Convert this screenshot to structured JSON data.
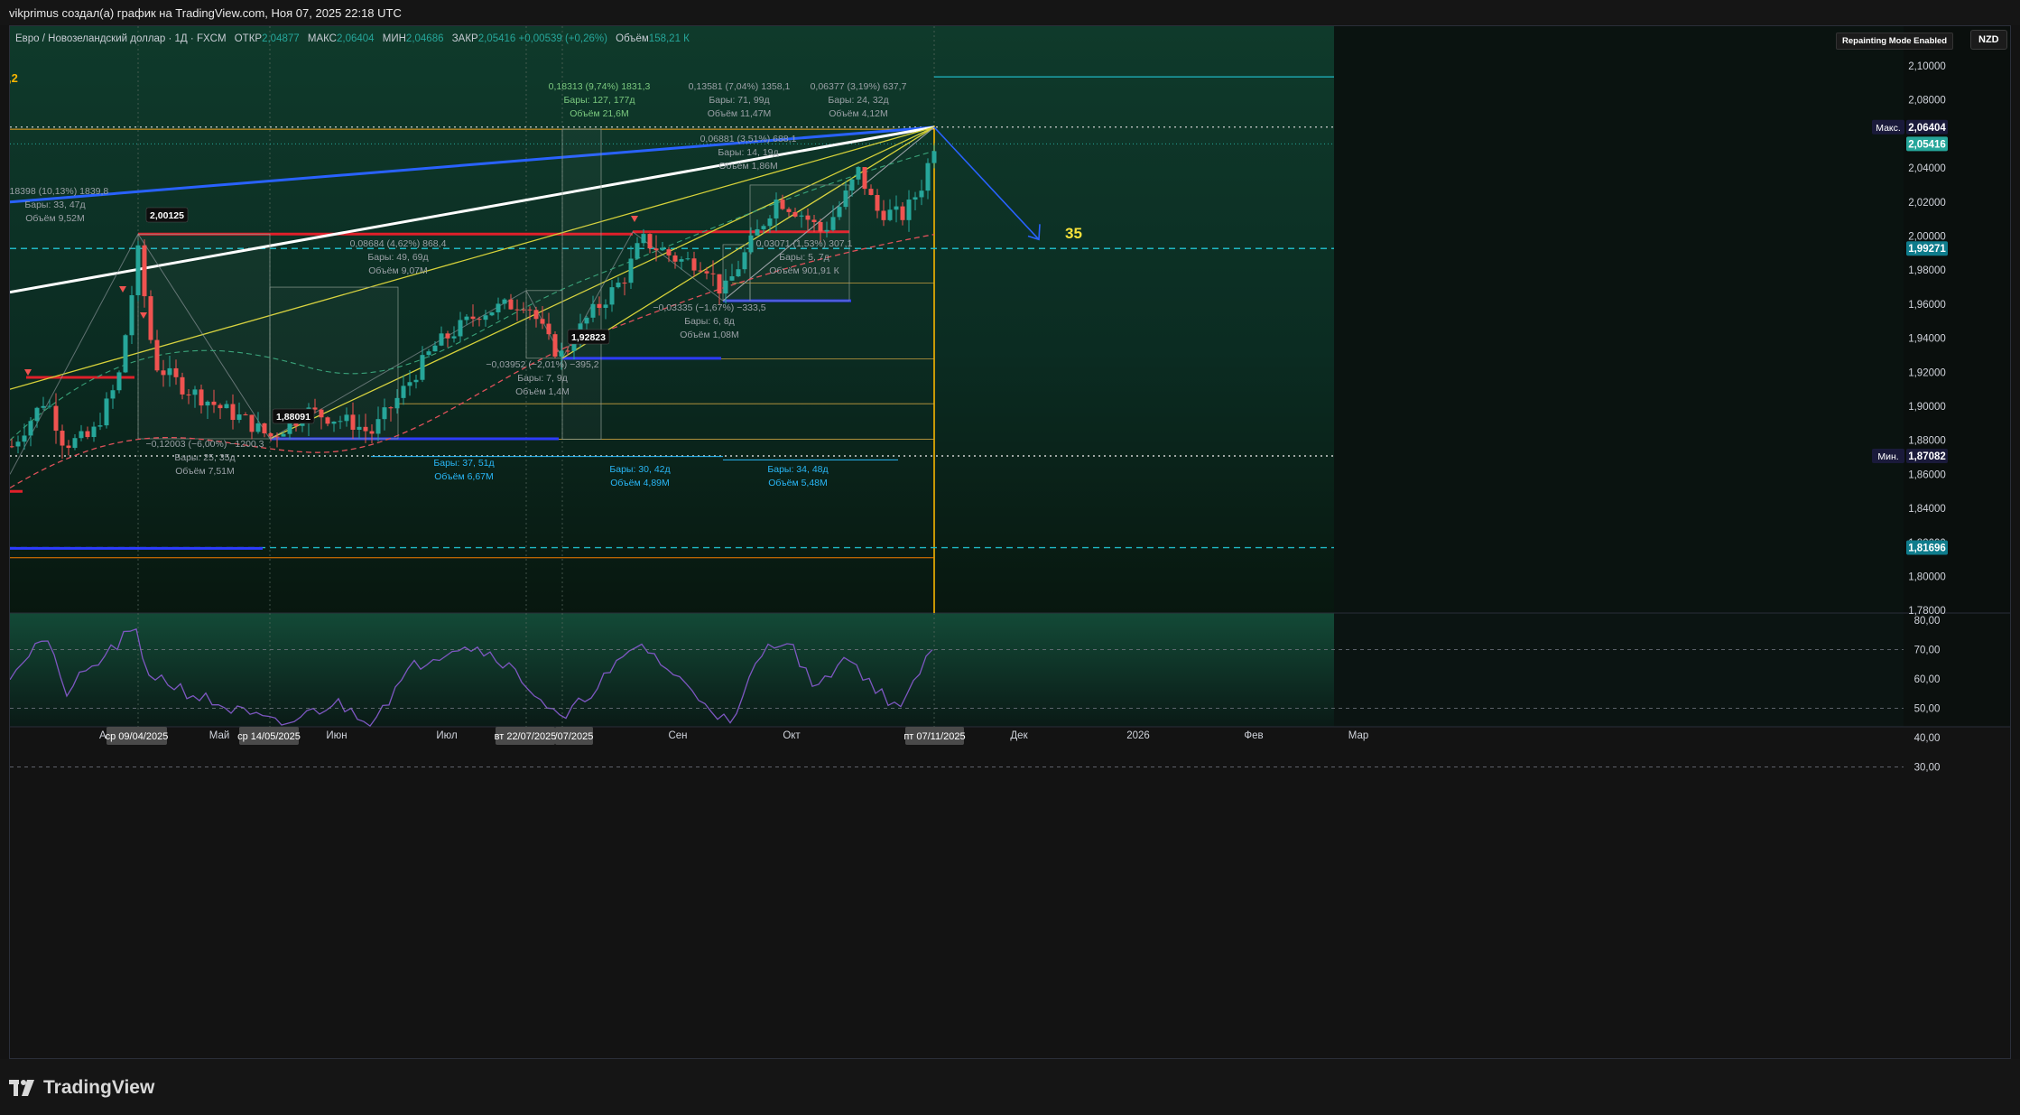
{
  "header": {
    "title": "vikprimus создал(а) график на TradingView.com, Ноя 07, 2025 22:18 UTC"
  },
  "legend": {
    "symbol": "Евро / Новозеландский доллар · 1Д · FXCM",
    "open_label": "ОТКР",
    "open": "2,04877",
    "high_label": "МАКС",
    "high": "2,06404",
    "low_label": "МИН",
    "low": "2,04686",
    "close_label": "ЗАКР",
    "close": "2,05416",
    "change": "+0,00539 (+0,26%)",
    "volume_label": "Объём",
    "volume": "158,21 К"
  },
  "badges": {
    "repainting": "Repainting Mode Enabled",
    "currency": "NZD"
  },
  "left_marker": ",2",
  "big_number": "35",
  "price_axis": {
    "ticks": [
      "2,10000",
      "2,08000",
      "2,04000",
      "2,02000",
      "2,00000",
      "1,98000",
      "1,96000",
      "1,94000",
      "1,92000",
      "1,90000",
      "1,88000",
      "1,86000",
      "1,84000",
      "1,82000",
      "1,80000",
      "1,78000"
    ],
    "labels": [
      {
        "text": "2,06404",
        "tag": "Макс.",
        "color": "#1a1a3a"
      },
      {
        "text": "2,05416",
        "tag": "",
        "color": "#26a69a"
      },
      {
        "text": "1,99271",
        "tag": "",
        "color": "#0f7c8c"
      },
      {
        "text": "1,87082",
        "tag": "Мин.",
        "color": "#1a1a3a"
      },
      {
        "text": "1,81696",
        "tag": "",
        "color": "#0f7c8c"
      }
    ]
  },
  "rsi_axis": {
    "ticks": [
      "80,00",
      "70,00",
      "60,00",
      "50,00",
      "40,00",
      "30,00"
    ]
  },
  "time_axis": {
    "ticks": [
      "Ап",
      "Май",
      "Июн",
      "Июл",
      "Сен",
      "Окт",
      "Дек",
      "2026",
      "Фев",
      "Мар"
    ],
    "highlights": [
      "ср 09/04/2025",
      "ср 14/05/2025",
      "вт 22/07/2025",
      "/07/2025",
      "пт 07/11/2025"
    ]
  },
  "price_labels": {
    "p1": "2,00125",
    "p2": "1,88091",
    "p3": "1,92823"
  },
  "annotations": [
    {
      "id": "a1",
      "lines": [
        "0,18313 (9,74%) 1831,3",
        "Бары: 127, 177д",
        "Объём 21,6М"
      ],
      "color": "#7bc97f"
    },
    {
      "id": "a2",
      "lines": [
        "0,13581 (7,04%) 1358,1",
        "Бары: 71, 99д",
        "Объём 11,47М"
      ],
      "color": "#9aa0a6"
    },
    {
      "id": "a3",
      "lines": [
        "0,06377 (3,19%) 637,7",
        "Бары: 24, 32д",
        "Объём 4,12М"
      ],
      "color": "#9aa0a6"
    },
    {
      "id": "a4",
      "lines": [
        "0,06881 (3,51%) 688,1",
        "Бары: 14, 19д",
        "Объём 1,86М"
      ],
      "color": "#9aa0a6"
    },
    {
      "id": "a5",
      "lines": [
        "0,18398 (10,13%) 1839,8",
        "Бары: 33, 47д",
        "Объём 9,52М"
      ],
      "color": "#9aa0a6"
    },
    {
      "id": "a6",
      "lines": [
        "0,08684 (4,62%) 868,4",
        "Бары: 49, 69д",
        "Объём 9,07М"
      ],
      "color": "#9aa0a6"
    },
    {
      "id": "a7",
      "lines": [
        "0,03071 (1,53%) 307,1",
        "Бары: 5, 7д",
        "Объём 901,91 К"
      ],
      "color": "#9aa0a6"
    },
    {
      "id": "a8",
      "lines": [
        "−0,03335 (−1,67%) −333,5",
        "Бары: 6, 8д",
        "Объём 1,08М"
      ],
      "color": "#9aa0a6"
    },
    {
      "id": "a9",
      "lines": [
        "−0,03952 (−2,01%) −395,2",
        "Бары: 7, 9д",
        "Объём 1,4М"
      ],
      "color": "#9aa0a6"
    },
    {
      "id": "a10",
      "lines": [
        "−0,12003 (−6,00%) −1200,3",
        "Бары: 25, 35д",
        "Объём 7,51М"
      ],
      "color": "#9aa0a6"
    },
    {
      "id": "a11",
      "lines": [
        "Бары: 37, 51д",
        "Объём 6,67М"
      ],
      "color": "#29b6f6"
    },
    {
      "id": "a12",
      "lines": [
        "Бары: 30, 42д",
        "Объём 4,89М"
      ],
      "color": "#29b6f6"
    },
    {
      "id": "a13",
      "lines": [
        "Бары: 34, 48д",
        "Объём 5,48М"
      ],
      "color": "#29b6f6"
    }
  ],
  "brand": {
    "name": "TradingView"
  },
  "colors": {
    "bull": "#26a69a",
    "bear": "#ef5350",
    "rsi": "#7e57c2",
    "blue": "#2962ff",
    "gold": "#f7b500"
  }
}
